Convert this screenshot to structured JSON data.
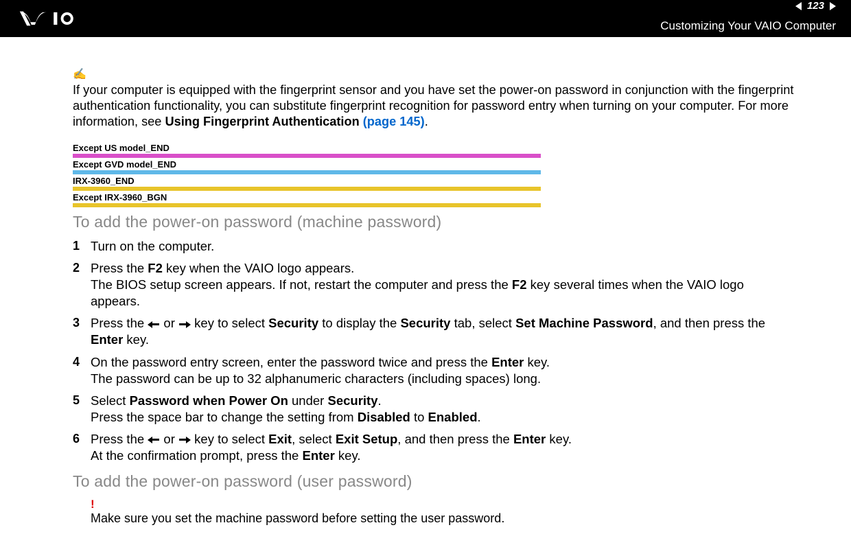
{
  "header": {
    "page_number": "123",
    "title": "Customizing Your VAIO Computer"
  },
  "note": {
    "text_1": "If your computer is equipped with the fingerprint sensor and you have set the power-on password in conjunction with the fingerprint authentication functionality, you can substitute fingerprint recognition for password entry when turning on your computer. For more information, see ",
    "bold_1": "Using Fingerprint Authentication ",
    "link_1": "(page 145)",
    "tail": "."
  },
  "tags": [
    {
      "label": "Except US model_END",
      "color": "magenta"
    },
    {
      "label": "Except GVD model_END",
      "color": "cyan"
    },
    {
      "label": "IRX-3960_END",
      "color": "yellow"
    },
    {
      "label": "Except IRX-3960_BGN",
      "color": "yellow",
      "below": true
    }
  ],
  "section1": {
    "heading": "To add the power-on password (machine password)",
    "steps": {
      "s1": "Turn on the computer.",
      "s2a": "Press the ",
      "s2b": "F2",
      "s2c": " key when the VAIO logo appears.",
      "s2d": "The BIOS setup screen appears. If not, restart the computer and press the ",
      "s2e": "F2",
      "s2f": " key several times when the VAIO logo appears.",
      "s3a": "Press the ",
      "s3b": " or ",
      "s3c": " key to select ",
      "s3d": "Security",
      "s3e": " to display the ",
      "s3f": "Security",
      "s3g": " tab, select ",
      "s3h": "Set Machine Password",
      "s3i": ", and then press the ",
      "s3j": "Enter",
      "s3k": " key.",
      "s4a": "On the password entry screen, enter the password twice and press the ",
      "s4b": "Enter",
      "s4c": " key.",
      "s4d": "The password can be up to 32 alphanumeric characters (including spaces) long.",
      "s5a": "Select ",
      "s5b": "Password when Power On",
      "s5c": " under ",
      "s5d": "Security",
      "s5e": ".",
      "s5f": "Press the space bar to change the setting from ",
      "s5g": "Disabled",
      "s5h": " to ",
      "s5i": "Enabled",
      "s5j": ".",
      "s6a": "Press the ",
      "s6b": " or ",
      "s6c": " key to select ",
      "s6d": "Exit",
      "s6e": ", select ",
      "s6f": "Exit Setup",
      "s6g": ", and then press the ",
      "s6h": "Enter",
      "s6i": " key.",
      "s6j": "At the confirmation prompt, press the ",
      "s6k": "Enter",
      "s6l": " key."
    }
  },
  "section2": {
    "heading": "To add the power-on password (user password)",
    "warning": "Make sure you set the machine password before setting the user password."
  }
}
